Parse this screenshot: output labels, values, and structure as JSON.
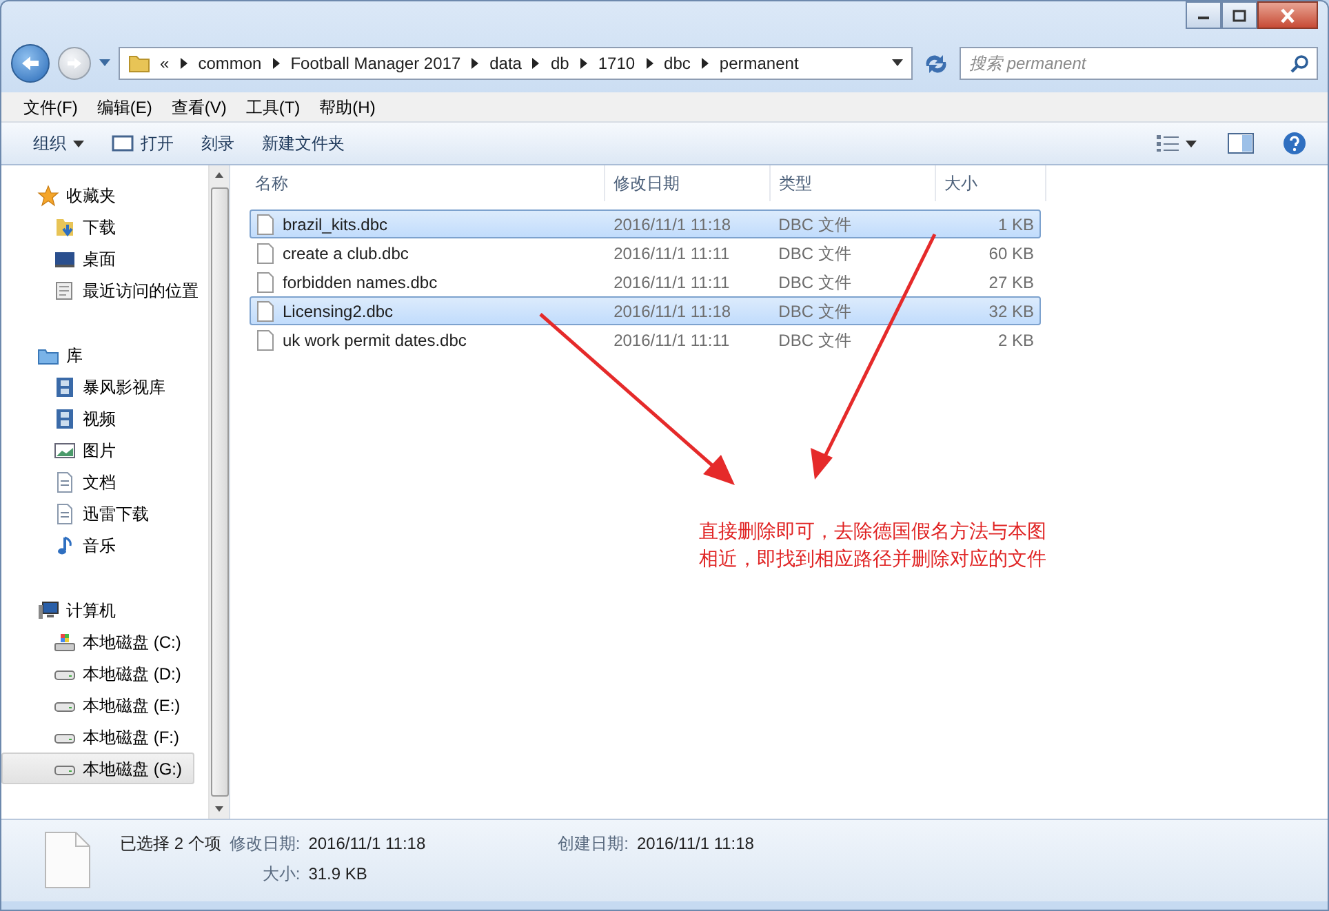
{
  "address": {
    "overflow": "«",
    "segments": [
      "common",
      "Football Manager 2017",
      "data",
      "db",
      "1710",
      "dbc",
      "permanent"
    ]
  },
  "search": {
    "placeholder": "搜索 permanent"
  },
  "menu": [
    "文件(F)",
    "编辑(E)",
    "查看(V)",
    "工具(T)",
    "帮助(H)"
  ],
  "toolbar": [
    {
      "label": "组织",
      "kind": "dropdown"
    },
    {
      "label": "打开",
      "kind": "open"
    },
    {
      "label": "刻录",
      "kind": "plain"
    },
    {
      "label": "新建文件夹",
      "kind": "plain"
    }
  ],
  "sidebar": [
    {
      "label": "收藏夹",
      "kind": "favorites",
      "children": [
        {
          "label": "下载",
          "kind": "download",
          "selected": false
        },
        {
          "label": "桌面",
          "kind": "desktop",
          "selected": false
        },
        {
          "label": "最近访问的位置",
          "kind": "recent",
          "selected": false
        }
      ]
    },
    {
      "label": "库",
      "kind": "library",
      "children": [
        {
          "label": "暴风影视库",
          "kind": "video",
          "selected": false
        },
        {
          "label": "视频",
          "kind": "video",
          "selected": false
        },
        {
          "label": "图片",
          "kind": "picture",
          "selected": false
        },
        {
          "label": "文档",
          "kind": "document",
          "selected": false
        },
        {
          "label": "迅雷下载",
          "kind": "document",
          "selected": false
        },
        {
          "label": "音乐",
          "kind": "music",
          "selected": false
        }
      ]
    },
    {
      "label": "计算机",
      "kind": "computer",
      "children": [
        {
          "label": "本地磁盘 (C:)",
          "kind": "system-drive",
          "selected": false
        },
        {
          "label": "本地磁盘 (D:)",
          "kind": "drive",
          "selected": false
        },
        {
          "label": "本地磁盘 (E:)",
          "kind": "drive",
          "selected": false
        },
        {
          "label": "本地磁盘 (F:)",
          "kind": "drive",
          "selected": false
        },
        {
          "label": "本地磁盘 (G:)",
          "kind": "drive",
          "selected": true
        }
      ]
    }
  ],
  "table": {
    "columns": [
      "名称",
      "修改日期",
      "类型",
      "大小"
    ],
    "rows": [
      {
        "cells": [
          "brazil_kits.dbc",
          "2016/11/1 11:18",
          "DBC 文件",
          "1 KB"
        ],
        "selected": true
      },
      {
        "cells": [
          "create a club.dbc",
          "2016/11/1 11:11",
          "DBC 文件",
          "60 KB"
        ],
        "selected": false
      },
      {
        "cells": [
          "forbidden names.dbc",
          "2016/11/1 11:11",
          "DBC 文件",
          "27 KB"
        ],
        "selected": false
      },
      {
        "cells": [
          "Licensing2.dbc",
          "2016/11/1 11:18",
          "DBC 文件",
          "32 KB"
        ],
        "selected": true
      },
      {
        "cells": [
          "uk work permit dates.dbc",
          "2016/11/1 11:11",
          "DBC 文件",
          "2 KB"
        ],
        "selected": false
      }
    ]
  },
  "annotation": {
    "lines": [
      "直接删除即可，去除德国假名方法与本图",
      "相近，即找到相应路径并删除对应的文件"
    ]
  },
  "status": {
    "summary": "已选择 2 个项",
    "details": [
      {
        "label": "修改日期:",
        "value": "2016/11/1 11:18"
      },
      {
        "label": "创建日期:",
        "value": "2016/11/1 11:18"
      },
      {
        "label": "大小:",
        "value": "31.9 KB"
      }
    ]
  }
}
